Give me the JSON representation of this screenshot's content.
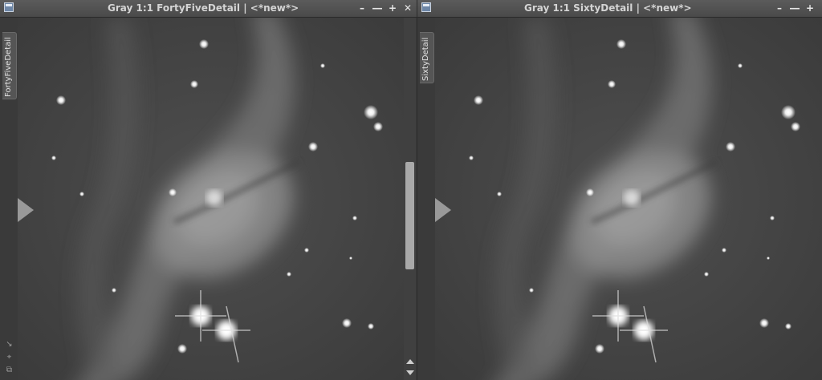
{
  "windows": [
    {
      "title": "Gray 1:1 FortyFiveDetail | <*new*>",
      "tab_label": "FortyFiveDetail",
      "buttons": {
        "minimize": "–",
        "shade": "―",
        "maximize": "+",
        "close": "✕"
      }
    },
    {
      "title": "Gray 1:1 SixtyDetail | <*new*>",
      "tab_label": "SixtyDetail",
      "buttons": {
        "minimize": "–",
        "shade": "―",
        "maximize": "+"
      }
    }
  ],
  "colors": {
    "titlebar": "#4e4e4e",
    "background": "#3a3a3a",
    "image_mid": "#505050"
  }
}
